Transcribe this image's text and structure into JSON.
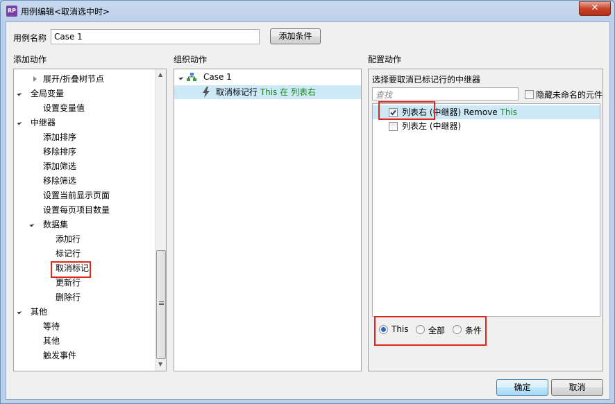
{
  "window": {
    "title": "用例编辑<取消选中时>",
    "app_icon": "RP",
    "close_symbol": "✕"
  },
  "case_name": {
    "label": "用例名称",
    "value": "Case 1",
    "add_condition": "添加条件"
  },
  "add_action": {
    "header": "添加动作",
    "items": [
      {
        "label": "展开/折叠树节点",
        "level": 1,
        "toggle": "right"
      },
      {
        "label": "全局变量",
        "level": 0,
        "toggle": "down"
      },
      {
        "label": "设置变量值",
        "level": 1
      },
      {
        "label": "中继器",
        "level": 0,
        "toggle": "down"
      },
      {
        "label": "添加排序",
        "level": 1
      },
      {
        "label": "移除排序",
        "level": 1
      },
      {
        "label": "添加筛选",
        "level": 1
      },
      {
        "label": "移除筛选",
        "level": 1
      },
      {
        "label": "设置当前显示页面",
        "level": 1
      },
      {
        "label": "设置每页项目数量",
        "level": 1
      },
      {
        "label": "数据集",
        "level": 1,
        "toggle": "down"
      },
      {
        "label": "添加行",
        "level": 2
      },
      {
        "label": "标记行",
        "level": 2
      },
      {
        "label": "取消标记",
        "level": 2,
        "highlighted": true
      },
      {
        "label": "更新行",
        "level": 2
      },
      {
        "label": "删除行",
        "level": 2
      },
      {
        "label": "其他",
        "level": 0,
        "toggle": "down"
      },
      {
        "label": "等待",
        "level": 1
      },
      {
        "label": "其他",
        "level": 1
      },
      {
        "label": "触发事件",
        "level": 1
      }
    ]
  },
  "organize_action": {
    "header": "组织动作",
    "case_label": "Case 1",
    "action": {
      "prefix": "取消标记行 ",
      "target": "This 在 列表右"
    }
  },
  "configure_action": {
    "header": "配置动作",
    "subheader": "选择要取消已标记行的中继器",
    "search_placeholder": "查找",
    "hide_unnamed": "隐藏未命名的元件",
    "repeaters": [
      {
        "name": "列表右 (中继器) Remove ",
        "suffix": "This",
        "checked": true,
        "selected": true
      },
      {
        "name": "列表左 (中继器)",
        "suffix": "",
        "checked": false,
        "selected": false
      }
    ],
    "radios": [
      {
        "label": "This",
        "selected": true
      },
      {
        "label": "全部",
        "selected": false
      },
      {
        "label": "条件",
        "selected": false
      }
    ]
  },
  "footer": {
    "ok": "确定",
    "cancel": "取消"
  },
  "colors": {
    "accent_red": "#e3261c",
    "selected_row": "#cde8f6",
    "green_text": "#1a8c1a"
  }
}
